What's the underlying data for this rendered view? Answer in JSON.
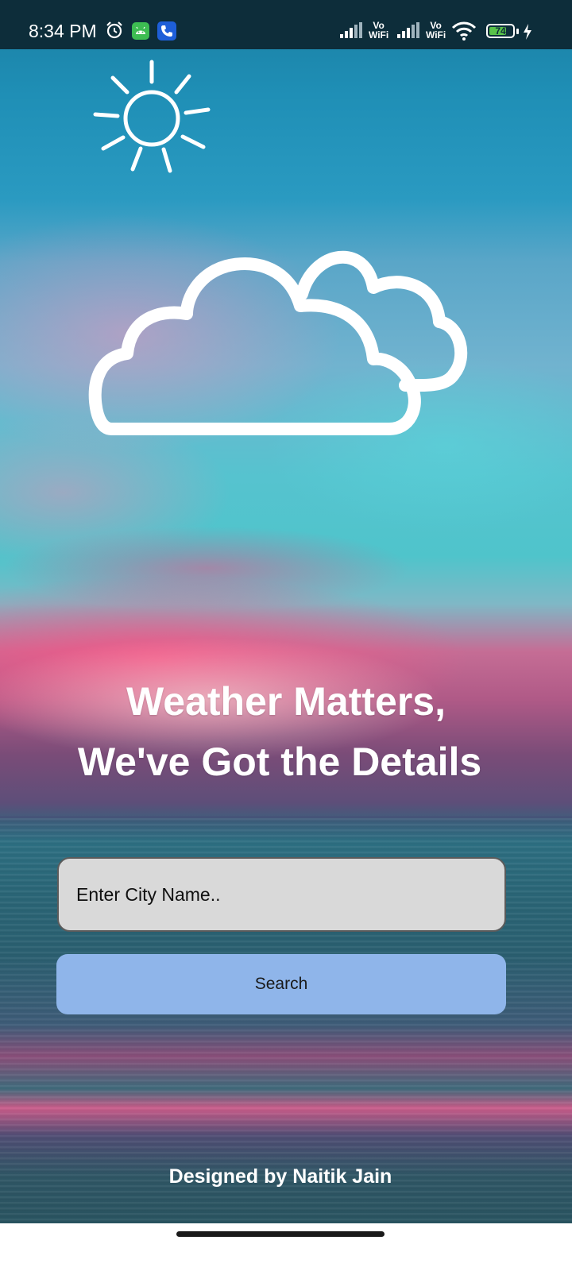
{
  "status_bar": {
    "time": "8:34 PM",
    "icons": [
      "alarm-icon",
      "android-app-icon",
      "phone-app-icon",
      "signal-icon",
      "wifi-icon",
      "charging-icon"
    ],
    "vowifi_line1": "Vo",
    "vowifi_line2": "WiFi",
    "battery_level": "74",
    "battery_fraction": 0.74
  },
  "hero": {
    "icons": [
      "sun-icon",
      "cloud-icon"
    ],
    "headline_line1": "Weather Matters,",
    "headline_line2": "We've Got the Details"
  },
  "form": {
    "city_placeholder": "Enter City Name..",
    "city_value": "",
    "search_label": "Search"
  },
  "footer": {
    "credit": "Designed by Naitik Jain"
  },
  "colors": {
    "input_bg": "#d9d9d9",
    "button_bg": "#8fb5ea",
    "text_light": "#ffffff"
  }
}
